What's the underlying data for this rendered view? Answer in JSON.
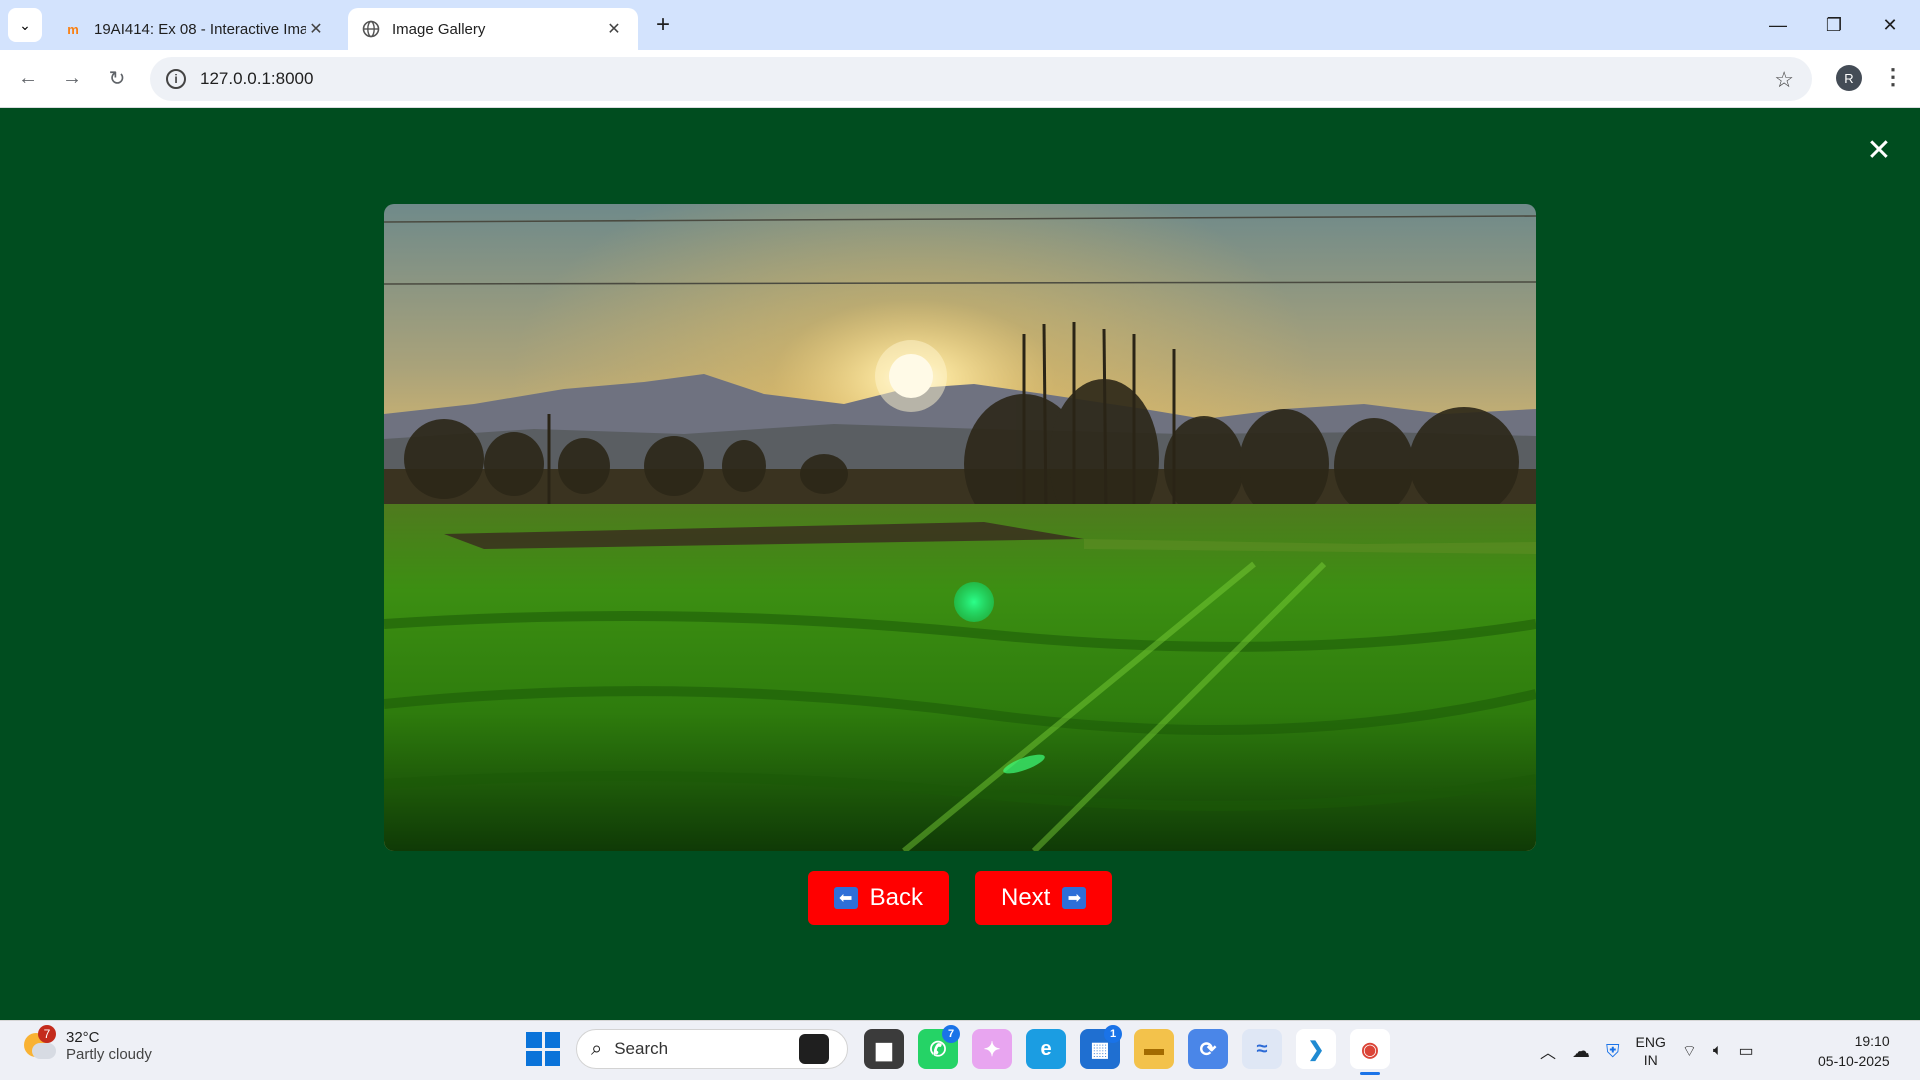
{
  "browser": {
    "tabs": [
      {
        "title": "19AI414: Ex 08 - Interactive Ima",
        "favicon": "moodle-icon",
        "active": false
      },
      {
        "title": "Image Gallery",
        "favicon": "globe-icon",
        "active": true
      }
    ],
    "new_tab_label": "+",
    "url": "127.0.0.1:8000",
    "profile_initial": "R"
  },
  "page": {
    "background_color": "#004d1f",
    "close_label": "✕",
    "image": {
      "subject": "sunset over green meadow with mountains and trees"
    },
    "buttons": {
      "back_label": "Back",
      "back_icon": "⬅",
      "next_label": "Next",
      "next_icon": "➡",
      "color": "#ff0000"
    }
  },
  "taskbar": {
    "weather": {
      "temp": "32°C",
      "condition": "Partly cloudy",
      "badge": "7"
    },
    "search_placeholder": "Search",
    "apps": [
      {
        "name": "task-view",
        "glyph": "▆",
        "bg": "#3b3b3b",
        "color": "#fff"
      },
      {
        "name": "whatsapp",
        "glyph": "✆",
        "bg": "#25d366",
        "color": "#fff",
        "badge": "7"
      },
      {
        "name": "copilot",
        "glyph": "✦",
        "bg": "#e8a5f0",
        "color": "#fff"
      },
      {
        "name": "edge",
        "glyph": "e",
        "bg": "#1b9de2",
        "color": "#fff"
      },
      {
        "name": "store",
        "glyph": "▦",
        "bg": "#1f6fd1",
        "color": "#fff",
        "badge": "1"
      },
      {
        "name": "file-explorer",
        "glyph": "▬",
        "bg": "#f3c24b",
        "color": "#a36b00"
      },
      {
        "name": "sync-app",
        "glyph": "⟳",
        "bg": "#4a86e8",
        "color": "#fff"
      },
      {
        "name": "cirrus",
        "glyph": "≈",
        "bg": "#dfe7f5",
        "color": "#2d6bd6"
      },
      {
        "name": "vscode",
        "glyph": "❯",
        "bg": "#ffffff",
        "color": "#1f8ad2"
      },
      {
        "name": "chrome",
        "glyph": "◉",
        "bg": "#ffffff",
        "color": "#db4437",
        "active": true
      }
    ],
    "language": {
      "line1": "ENG",
      "line2": "IN"
    },
    "time": "19:10",
    "date": "05-10-2025"
  }
}
